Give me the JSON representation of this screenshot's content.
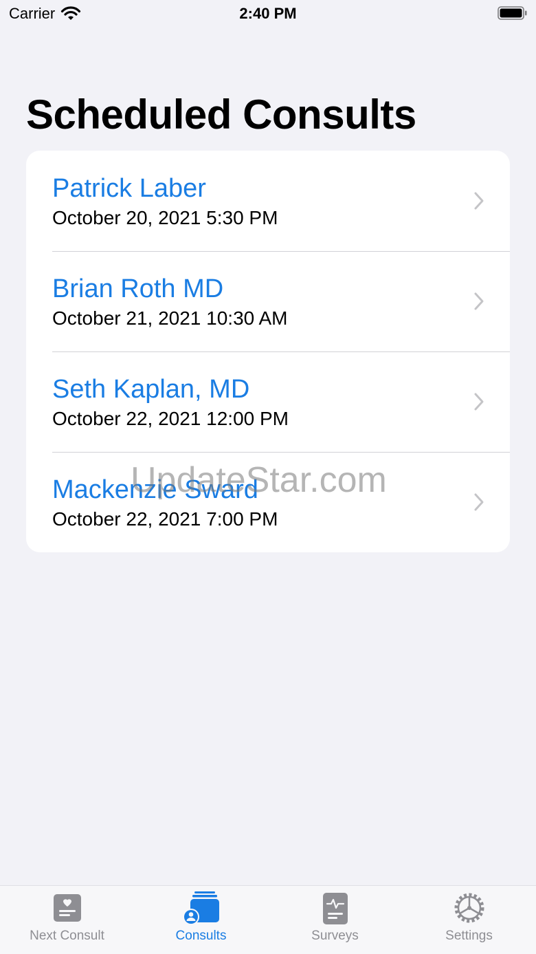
{
  "status_bar": {
    "carrier": "Carrier",
    "time": "2:40 PM"
  },
  "page": {
    "title": "Scheduled Consults"
  },
  "consults": [
    {
      "name": "Patrick Laber",
      "datetime": "October 20, 2021 5:30 PM"
    },
    {
      "name": "Brian Roth MD",
      "datetime": "October 21, 2021 10:30 AM"
    },
    {
      "name": "Seth Kaplan, MD",
      "datetime": "October 22, 2021 12:00 PM"
    },
    {
      "name": "Mackenzie Sward",
      "datetime": "October 22, 2021 7:00 PM"
    }
  ],
  "watermark": "UpdateStar.com",
  "tab_bar": {
    "tabs": [
      {
        "label": "Next Consult",
        "icon": "heart-card-icon",
        "active": false
      },
      {
        "label": "Consults",
        "icon": "stacked-consults-icon",
        "active": true
      },
      {
        "label": "Surveys",
        "icon": "survey-doc-icon",
        "active": false
      },
      {
        "label": "Settings",
        "icon": "gear-icon",
        "active": false
      }
    ]
  },
  "colors": {
    "accent": "#1a7de3",
    "inactive": "#8e8e93",
    "background": "#f2f2f7"
  }
}
